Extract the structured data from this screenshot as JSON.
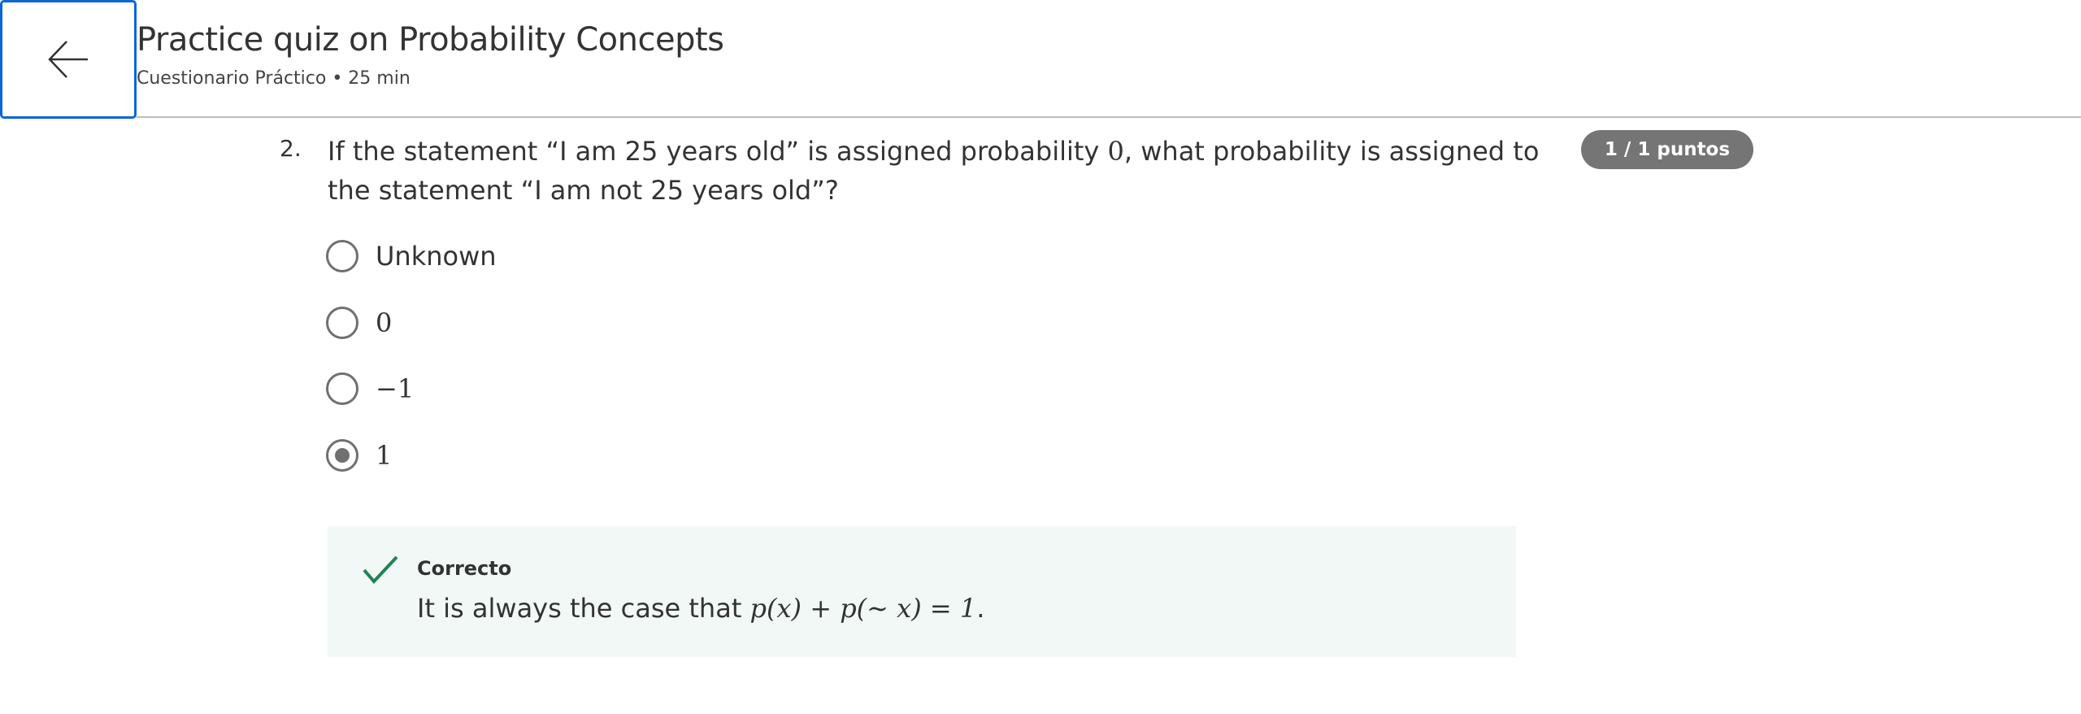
{
  "header": {
    "back_label": "Back",
    "title": "Practice quiz on Probability Concepts",
    "subtitle": "Cuestionario Práctico • 25 min"
  },
  "question": {
    "number": "2.",
    "text_before": "If the statement “I am 25 years old” is assigned probability ",
    "text_math": "0",
    "text_after": ", what probability is assigned to the statement “I am not 25 years old”?",
    "score_badge": "1 / 1 puntos",
    "options": [
      {
        "label": "Unknown",
        "selected": false
      },
      {
        "label": "0",
        "selected": false
      },
      {
        "label": "−1",
        "selected": false
      },
      {
        "label": "1",
        "selected": true
      }
    ]
  },
  "feedback": {
    "status": "Correcto",
    "text": "It is always the case that ",
    "formula": "p(x) + p(∼ x) = 1",
    "trailing": ".",
    "color": "#1f8354"
  }
}
